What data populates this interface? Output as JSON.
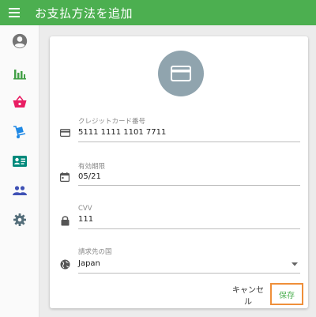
{
  "appbar": {
    "title": "お支払方法を追加",
    "color": "#4caf50"
  },
  "sidebar": {
    "items": [
      {
        "icon": "account-circle-icon",
        "color": "#757575"
      },
      {
        "icon": "bar-chart-icon",
        "color": "#43a047"
      },
      {
        "icon": "basket-icon",
        "color": "#e91e63"
      },
      {
        "icon": "dolly-icon",
        "color": "#1e88e5"
      },
      {
        "icon": "contact-card-icon",
        "color": "#00897b"
      },
      {
        "icon": "people-icon",
        "color": "#3f51b5"
      },
      {
        "icon": "gear-icon",
        "color": "#546e7a"
      }
    ]
  },
  "form": {
    "avatar_icon": "credit-card-icon",
    "card_number": {
      "label": "クレジットカード番号",
      "value": "5111 1111 1101 7711",
      "icon": "credit-card-icon"
    },
    "expiry": {
      "label": "有効期限",
      "value": "05/21",
      "icon": "calendar-icon"
    },
    "cvv": {
      "label": "CVV",
      "value": "111",
      "icon": "lock-icon"
    },
    "country": {
      "label": "請求先の国",
      "value": "Japan",
      "icon": "globe-icon"
    }
  },
  "actions": {
    "cancel_label": "キャンセル",
    "save_label": "保存",
    "save_color": "#4caf50",
    "highlight_color": "#ef8f3a"
  }
}
